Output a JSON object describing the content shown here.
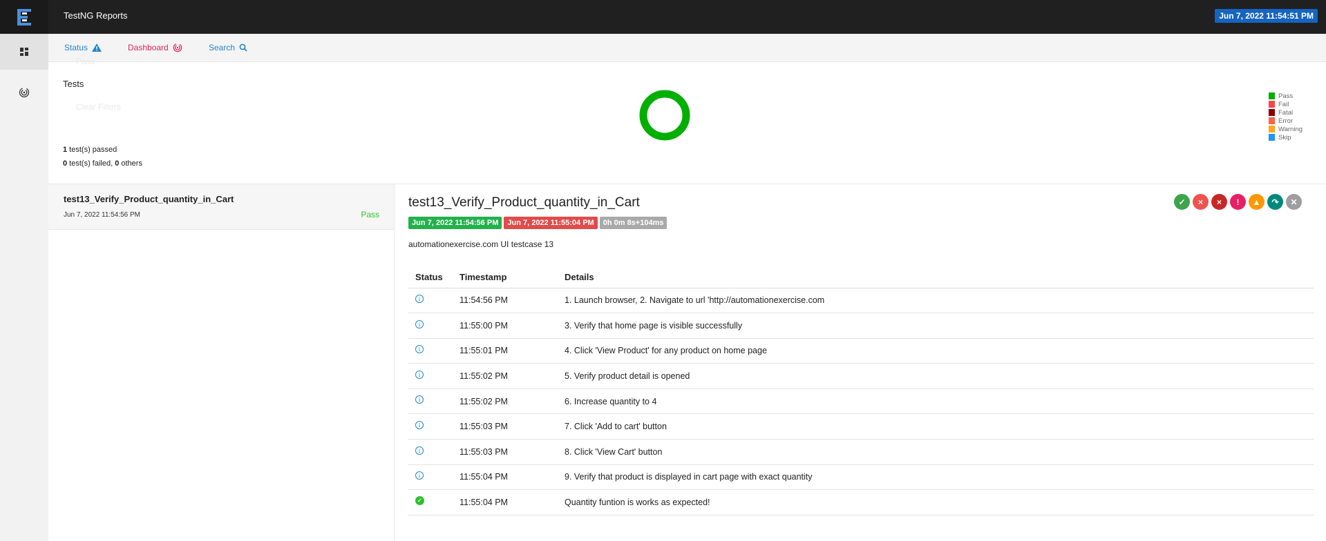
{
  "app": {
    "title": "TestNG Reports",
    "report_date": "Jun 7, 2022 11:54:51 PM"
  },
  "sidebar": {
    "items": [
      {
        "icon": "dashboard-grid-icon"
      },
      {
        "icon": "fingerprint-icon"
      }
    ]
  },
  "nav": {
    "status_label": "Status",
    "dashboard_label": "Dashboard",
    "search_label": "Search",
    "faded_item1": "Pass",
    "faded_item2": "Clear Filters"
  },
  "dashboard": {
    "title": "Tests",
    "passed_count": "1",
    "passed_text": " test(s) passed",
    "failed_count": "0",
    "failed_text": " test(s) failed, ",
    "others_count": "0",
    "others_text": " others",
    "legend": [
      {
        "label": "Pass",
        "color": "#00af00"
      },
      {
        "label": "Fail",
        "color": "#f7464a"
      },
      {
        "label": "Fatal",
        "color": "#8b0000"
      },
      {
        "label": "Error",
        "color": "#ff6347"
      },
      {
        "label": "Warning",
        "color": "#ffa81c"
      },
      {
        "label": "Skip",
        "color": "#2196f3"
      }
    ],
    "donut_color": "#00af00"
  },
  "test_list": [
    {
      "name": "test13_Verify_Product_quantity_in_Cart",
      "time": "Jun 7, 2022 11:54:56 PM",
      "status": "Pass"
    }
  ],
  "detail": {
    "title": "test13_Verify_Product_quantity_in_Cart",
    "start": "Jun 7, 2022 11:54:56 PM",
    "end": "Jun 7, 2022 11:55:04 PM",
    "duration": "0h 0m 8s+104ms",
    "description": "automationexercise.com UI testcase 13",
    "filter_buttons": [
      {
        "icon": "check-icon",
        "color": "#3ea44b"
      },
      {
        "icon": "fail-x-icon",
        "color": "#ef5350"
      },
      {
        "icon": "fatal-x-icon",
        "color": "#c62828"
      },
      {
        "icon": "error-exclamation-icon",
        "color": "#e91e63"
      },
      {
        "icon": "warning-triangle-icon",
        "color": "#ff9800"
      },
      {
        "icon": "skip-redo-icon",
        "color": "#00897b"
      },
      {
        "icon": "clear-x-icon",
        "color": "#9e9e9e"
      }
    ],
    "log_headers": {
      "status": "Status",
      "timestamp": "Timestamp",
      "details": "Details"
    },
    "logs": [
      {
        "status": "info",
        "time": "11:54:56 PM",
        "details": "1. Launch browser, 2. Navigate to url 'http://automationexercise.com"
      },
      {
        "status": "info",
        "time": "11:55:00 PM",
        "details": "3. Verify that home page is visible successfully"
      },
      {
        "status": "info",
        "time": "11:55:01 PM",
        "details": "4. Click 'View Product' for any product on home page"
      },
      {
        "status": "info",
        "time": "11:55:02 PM",
        "details": "5. Verify product detail is opened"
      },
      {
        "status": "info",
        "time": "11:55:02 PM",
        "details": "6. Increase quantity to 4"
      },
      {
        "status": "info",
        "time": "11:55:03 PM",
        "details": "7. Click 'Add to cart' button"
      },
      {
        "status": "info",
        "time": "11:55:03 PM",
        "details": "8. Click 'View Cart' button"
      },
      {
        "status": "info",
        "time": "11:55:04 PM",
        "details": "9. Verify that product is displayed in cart page with exact quantity"
      },
      {
        "status": "pass",
        "time": "11:55:04 PM",
        "details": "Quantity funtion is works as expected!"
      }
    ]
  }
}
